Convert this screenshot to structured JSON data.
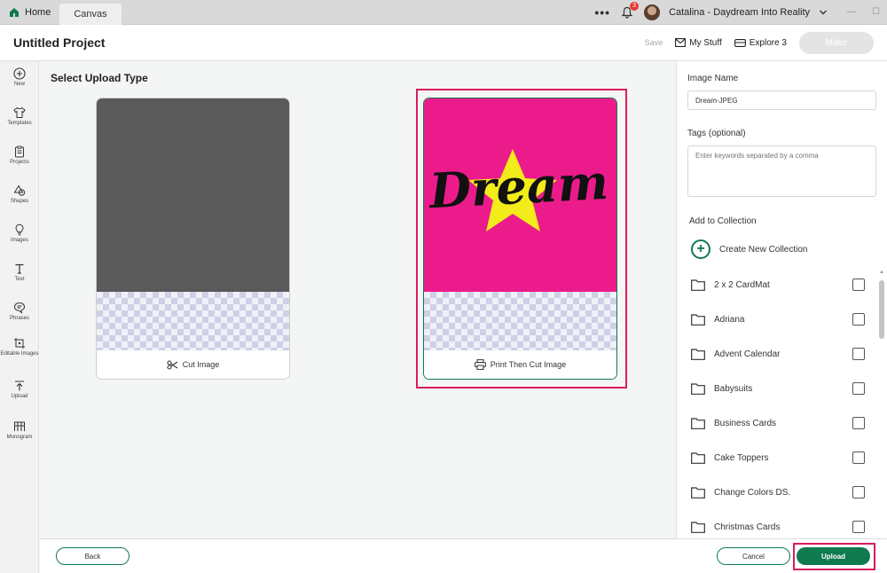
{
  "topbar": {
    "home_label": "Home",
    "canvas_label": "Canvas",
    "more_label": "•••",
    "notification_count": "3",
    "user_name": "Catalina - Daydream Into Reality",
    "icons": [
      "home-icon",
      "more-icon",
      "bell-icon",
      "avatar",
      "chevron-down-icon",
      "minimize-icon",
      "maximize-icon"
    ]
  },
  "header": {
    "title": "Untitled Project",
    "save_label": "Save",
    "my_stuff_label": "My Stuff",
    "explore_label": "Explore 3",
    "make_label": "Make"
  },
  "sidebar": {
    "items": [
      {
        "label": "New",
        "icon": "plus-circle-icon"
      },
      {
        "label": "Templates",
        "icon": "shirt-icon"
      },
      {
        "label": "Projects",
        "icon": "clipboard-icon"
      },
      {
        "label": "Shapes",
        "icon": "shapes-icon"
      },
      {
        "label": "Images",
        "icon": "bulb-icon"
      },
      {
        "label": "Text",
        "icon": "text-icon"
      },
      {
        "label": "Phrases",
        "icon": "speech-bubble-icon"
      },
      {
        "label": "Editable Images",
        "icon": "edit-image-icon"
      },
      {
        "label": "Upload",
        "icon": "upload-icon"
      },
      {
        "label": "Monogram",
        "icon": "monogram-icon"
      }
    ]
  },
  "main": {
    "title": "Select Upload Type",
    "cards": [
      {
        "caption": "Cut Image",
        "icon": "scissors-icon",
        "selected": false,
        "preview_color": "#595a59"
      },
      {
        "caption": "Print Then Cut Image",
        "icon": "printer-icon",
        "selected": true,
        "preview_color": "#ec1b8c",
        "preview_text": "Dream"
      }
    ]
  },
  "footer": {
    "back_label": "Back",
    "cancel_label": "Cancel",
    "upload_label": "Upload"
  },
  "panel": {
    "image_name_label": "Image Name",
    "image_name_value": "Dream-JPEG",
    "tags_label": "Tags (optional)",
    "tags_placeholder": "Enter keywords separated by a comma",
    "collection_label": "Add to Collection",
    "create_collection_label": "Create New Collection",
    "collections": [
      "2 x 2 CardMat",
      "Adriana",
      "Advent Calendar",
      "Babysuits",
      "Business Cards",
      "Cake Toppers",
      "Change Colors DS.",
      "Christmas Cards"
    ]
  },
  "colors": {
    "accent": "#0f7a4f",
    "highlight": "#d81b60",
    "magenta": "#ec1b8c",
    "star": "#f2ec1a"
  }
}
